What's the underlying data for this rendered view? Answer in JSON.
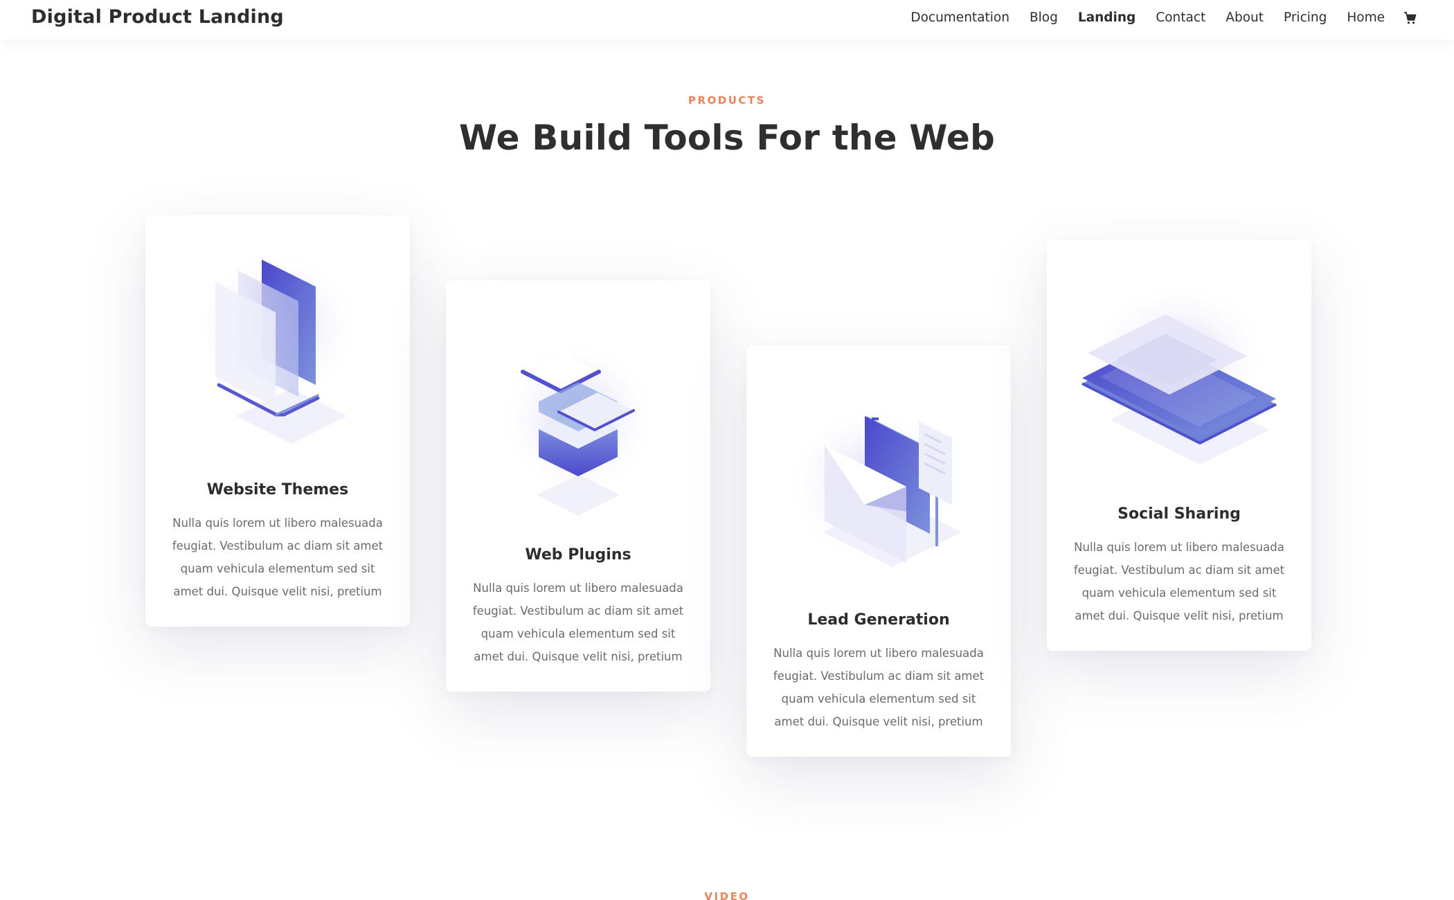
{
  "header": {
    "logo": "Digital Product Landing",
    "nav": [
      "Documentation",
      "Blog",
      "Landing",
      "Contact",
      "About",
      "Pricing",
      "Home"
    ],
    "active_nav": "Landing",
    "cart_icon": "cart-icon"
  },
  "products_section": {
    "eyebrow": "PRODUCTS",
    "title": "We Build Tools For the Web",
    "cards": [
      {
        "title": "Website Themes",
        "text": "Nulla quis lorem ut libero malesuada feugiat. Vestibulum ac diam sit amet quam vehicula elementum sed sit amet dui. Quisque velit nisi, pretium",
        "icon": "laptop-illustration-icon"
      },
      {
        "title": "Web Plugins",
        "text": "Nulla quis lorem ut libero malesuada feugiat. Vestibulum ac diam sit amet quam vehicula elementum sed sit amet dui. Quisque velit nisi, pretium",
        "icon": "stacked-layers-illustration-icon"
      },
      {
        "title": "Lead Generation",
        "text": "Nulla quis lorem ut libero malesuada feugiat. Vestibulum ac diam sit amet quam vehicula elementum sed sit amet dui. Quisque velit nisi, pretium",
        "icon": "envelope-document-illustration-icon"
      },
      {
        "title": "Social Sharing",
        "text": "Nulla quis lorem ut libero malesuada feugiat. Vestibulum ac diam sit amet quam vehicula elementum sed sit amet dui. Quisque velit nisi, pretium",
        "icon": "tablet-illustration-icon"
      }
    ]
  },
  "video_section": {
    "eyebrow": "VIDEO"
  },
  "colors": {
    "accent": "#e8845b",
    "heading": "#2f2f2f",
    "body_text": "#6a6a6a",
    "illustration_primary": "#5250cf",
    "illustration_secondary": "#7e93dc",
    "illustration_light": "#ecebf8"
  }
}
